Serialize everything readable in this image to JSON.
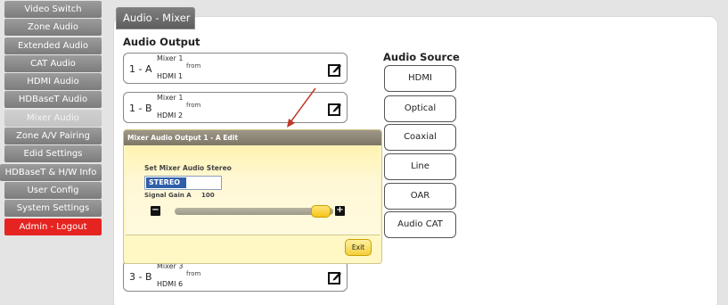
{
  "sidebar": {
    "items": [
      {
        "label": "Video Switch"
      },
      {
        "label": "Zone Audio"
      },
      {
        "label": "Extended Audio"
      },
      {
        "label": "CAT Audio"
      },
      {
        "label": "HDMI Audio"
      },
      {
        "label": "HDBaseT Audio"
      },
      {
        "label": "Mixer Audio"
      },
      {
        "label": "Zone A/V Pairing"
      },
      {
        "label": "Edid Settings"
      },
      {
        "label": "HDBaseT & H/W Info"
      },
      {
        "label": "User Config"
      },
      {
        "label": "System Settings"
      },
      {
        "label": "Admin - Logout"
      }
    ]
  },
  "header": {
    "section_title": "Audio - Mixer"
  },
  "audio_output": {
    "heading": "Audio Output",
    "mixers": [
      {
        "code": "1 - A",
        "mixer": "Mixer 1",
        "from": "from",
        "source": "HDMI 1"
      },
      {
        "code": "1 - B",
        "mixer": "Mixer 1",
        "from": "from",
        "source": "HDMI 2"
      },
      {
        "code": "3 - B",
        "mixer": "Mixer 3",
        "from": "from",
        "source": "HDMI 6"
      }
    ]
  },
  "audio_source": {
    "heading": "Audio Source",
    "buttons": [
      {
        "label": "HDMI"
      },
      {
        "label": "Optical"
      },
      {
        "label": "Coaxial"
      },
      {
        "label": "Line"
      },
      {
        "label": "OAR"
      },
      {
        "label": "Audio CAT"
      }
    ]
  },
  "popup": {
    "title": "Mixer Audio Output 1 - A Edit",
    "stereo_label": "Set Mixer Audio Stereo",
    "stereo_value": "STEREO",
    "gain_label": "Signal Gain A",
    "gain_value": "100",
    "minus": "−",
    "plus": "+",
    "exit_label": "Exit"
  },
  "colors": {
    "nav_bg": "#8a8a8a",
    "nav_active": "#c8c8c8",
    "logout": "#e52421",
    "popup_bg": "#fff7c4",
    "select_highlight": "#2f5fa8",
    "arrow": "#c0392b"
  }
}
